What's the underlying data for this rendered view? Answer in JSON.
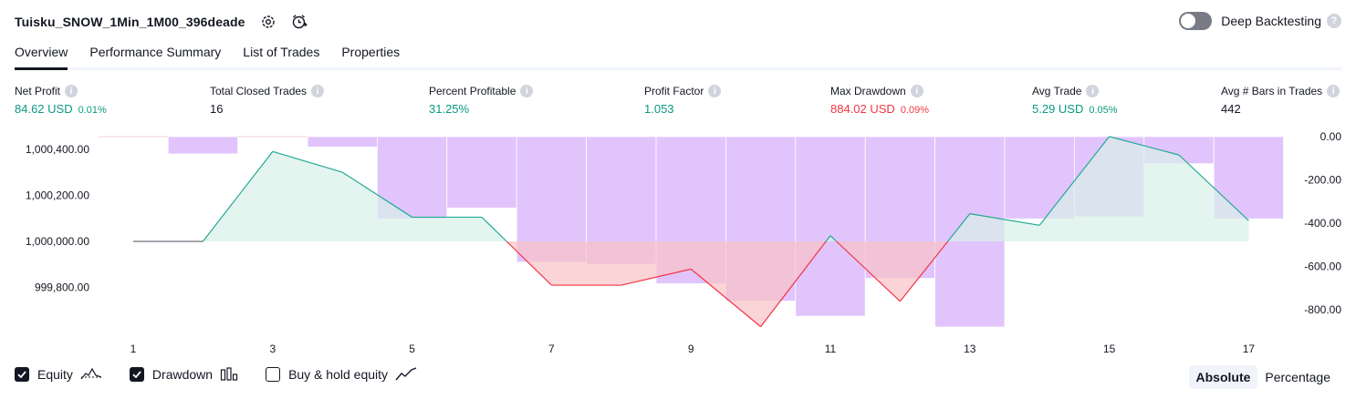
{
  "header": {
    "title": "Tuisku_SNOW_1Min_1M00_396deade",
    "settings_icon": "gear-icon",
    "alert_icon": "add-alert-clock-icon",
    "deep_backtesting_label": "Deep Backtesting",
    "deep_backtesting_enabled": false
  },
  "tabs": [
    {
      "label": "Overview",
      "active": true
    },
    {
      "label": "Performance Summary",
      "active": false
    },
    {
      "label": "List of Trades",
      "active": false
    },
    {
      "label": "Properties",
      "active": false
    }
  ],
  "metrics": [
    {
      "label": "Net Profit",
      "value": "84.62 USD",
      "sub": "0.01%",
      "color": "#089981"
    },
    {
      "label": "Total Closed Trades",
      "value": "16",
      "sub": "",
      "color": "#131722"
    },
    {
      "label": "Percent Profitable",
      "value": "31.25%",
      "sub": "",
      "color": "#089981"
    },
    {
      "label": "Profit Factor",
      "value": "1.053",
      "sub": "",
      "color": "#089981"
    },
    {
      "label": "Max Drawdown",
      "value": "884.02 USD",
      "sub": "0.09%",
      "color": "#f23645"
    },
    {
      "label": "Avg Trade",
      "value": "5.29 USD",
      "sub": "0.05%",
      "color": "#089981"
    },
    {
      "label": "Avg # Bars in Trades",
      "value": "442",
      "sub": "",
      "color": "#131722"
    }
  ],
  "chart_data": {
    "type": "line",
    "x": [
      1,
      2,
      3,
      4,
      5,
      6,
      7,
      8,
      9,
      10,
      11,
      12,
      13,
      14,
      15,
      16,
      17
    ],
    "x_tick_labels": [
      "1",
      "3",
      "5",
      "7",
      "9",
      "11",
      "13",
      "15",
      "17"
    ],
    "series": [
      {
        "name": "Equity",
        "type": "line",
        "axis": "left",
        "values": [
          1000000,
          1000000,
          1000390,
          1000300,
          1000105,
          1000105,
          999810,
          999810,
          999880,
          999630,
          1000025,
          999740,
          1000120,
          1000070,
          1000455,
          1000375,
          1000090
        ]
      },
      {
        "name": "Drawdown",
        "type": "bar",
        "axis": "right",
        "values": [
          0,
          -80,
          0,
          -48,
          -380,
          -330,
          -580,
          -590,
          -680,
          -760,
          -830,
          -655,
          -880,
          -380,
          -370,
          -125,
          -380
        ]
      }
    ],
    "left_axis": {
      "ticks": [
        "1,000,400.00",
        "1,000,200.00",
        "1,000,000.00",
        "999,800.00"
      ],
      "tick_values": [
        1000400,
        1000200,
        1000000,
        999800
      ]
    },
    "right_axis": {
      "ticks": [
        "0.00",
        "-200.00",
        "-400.00",
        "-600.00",
        "-800.00"
      ],
      "tick_values": [
        0,
        -200,
        -400,
        -600,
        -800
      ]
    },
    "baseline": 1000000,
    "colors": {
      "profit": "#22ab94",
      "loss": "#f23645",
      "drawdown": "#e1c4fc",
      "profit_fill": "#d8f1ea",
      "loss_fill": "#f9c2c6"
    }
  },
  "legend": [
    {
      "label": "Equity",
      "checked": true,
      "icon": "equity-line-icon"
    },
    {
      "label": "Drawdown",
      "checked": true,
      "icon": "drawdown-bars-icon"
    },
    {
      "label": "Buy & hold equity",
      "checked": false,
      "icon": "buy-hold-line-icon"
    }
  ],
  "modes": [
    {
      "label": "Absolute",
      "active": true
    },
    {
      "label": "Percentage",
      "active": false
    }
  ]
}
